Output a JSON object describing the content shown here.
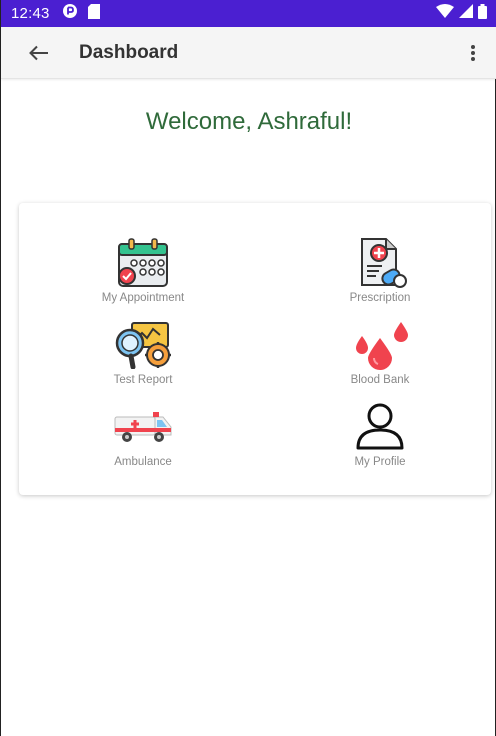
{
  "status_bar": {
    "time": "12:43"
  },
  "app_bar": {
    "title": "Dashboard"
  },
  "welcome": "Welcome, Ashraful!",
  "tiles": [
    {
      "label": "My Appointment",
      "icon": "calendar-icon"
    },
    {
      "label": "Prescription",
      "icon": "prescription-icon"
    },
    {
      "label": "Test Report",
      "icon": "test-report-icon"
    },
    {
      "label": "Blood Bank",
      "icon": "blood-drops-icon"
    },
    {
      "label": "Ambulance",
      "icon": "ambulance-icon"
    },
    {
      "label": "My Profile",
      "icon": "user-profile-icon"
    }
  ],
  "colors": {
    "status_bar": "#4b1fd1",
    "welcome_text": "#2f6a3a",
    "blood": "#f0434e"
  }
}
